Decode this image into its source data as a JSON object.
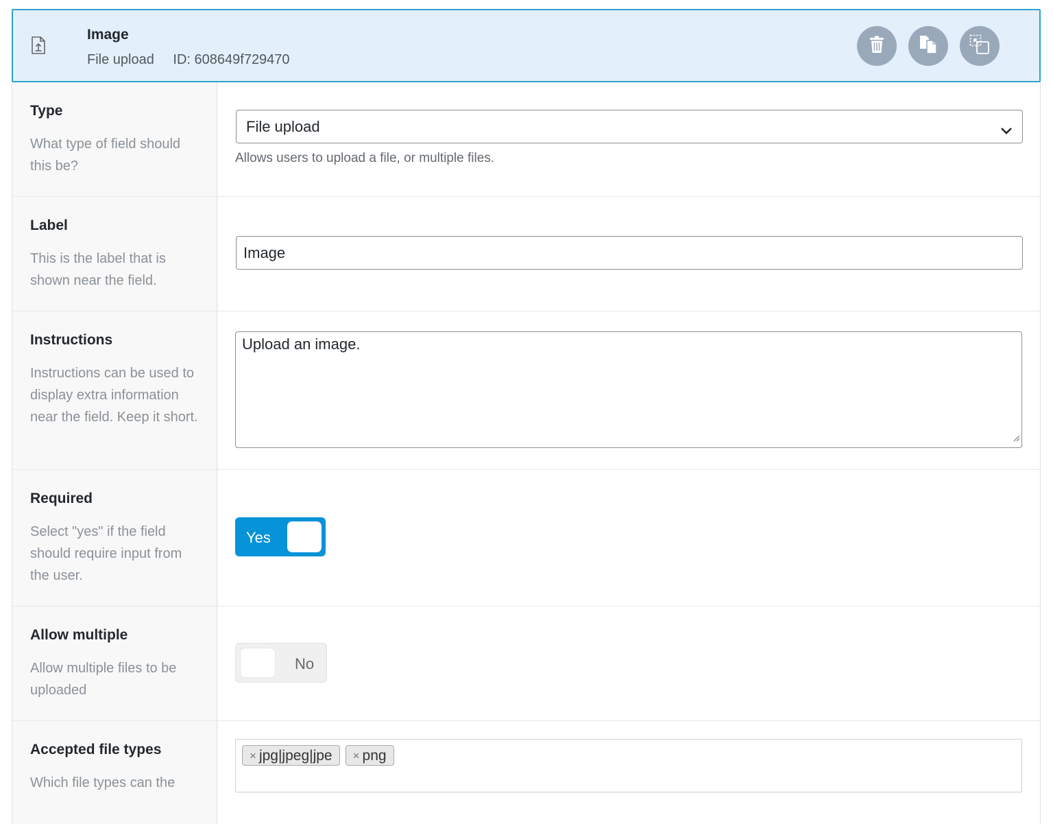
{
  "header": {
    "title": "Image",
    "type_label": "File upload",
    "id_label": "ID: 608649f729470",
    "actions": [
      "trash-icon",
      "duplicate-icon",
      "move-icon"
    ]
  },
  "rows": {
    "type": {
      "label": "Type",
      "description": "What type of field should this be?",
      "value": "File upload",
      "help": "Allows users to upload a file, or multiple files."
    },
    "label": {
      "label": "Label",
      "description": "This is the label that is shown near the field.",
      "value": "Image"
    },
    "instructions": {
      "label": "Instructions",
      "description": "Instructions can be used to display extra information near the field. Keep it short.",
      "value": "Upload an image."
    },
    "required": {
      "label": "Required",
      "description": "Select \"yes\" if the field should require input from the user.",
      "toggle_text": "Yes",
      "state": true
    },
    "allow_multiple": {
      "label": "Allow multiple",
      "description": "Allow multiple files to be uploaded",
      "toggle_text": "No",
      "state": false
    },
    "accepted_types": {
      "label": "Accepted file types",
      "description": "Which file types can the",
      "tags": [
        "jpg|jpeg|jpe",
        "png"
      ],
      "remove_glyph": "×"
    }
  },
  "colors": {
    "header_bg": "#e3f0fb",
    "header_border": "#2ea2cc",
    "toggle_on": "#0693d8",
    "action_btn": "#9aa9ba"
  }
}
